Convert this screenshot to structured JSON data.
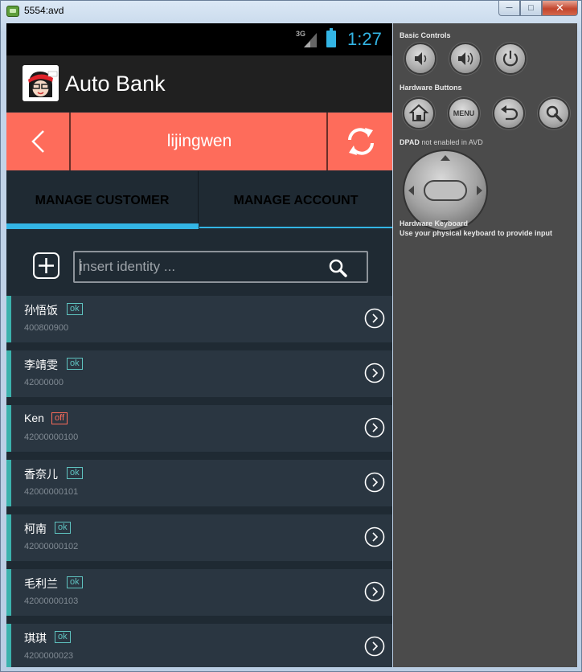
{
  "window": {
    "title": "5554:avd",
    "minimize": "─",
    "maximize": "□",
    "close": "✕"
  },
  "status_bar": {
    "network": "3G",
    "clock": "1:27",
    "icons": [
      "signal-icon",
      "battery-charging-icon"
    ]
  },
  "app_bar": {
    "title": "Auto Bank",
    "logo": "avatar-logo"
  },
  "user_bar": {
    "username": "lijingwen",
    "back_icon": "chevron-left-icon",
    "refresh_icon": "refresh-icon"
  },
  "tabs": [
    {
      "label": "MANAGE CUSTOMER",
      "selected": true
    },
    {
      "label": "MANAGE ACCOUNT",
      "selected": false
    }
  ],
  "search": {
    "placeholder": "insert identity ...",
    "value": ""
  },
  "customers": [
    {
      "name": "孙悟饭",
      "status": "ok",
      "id": "400800900"
    },
    {
      "name": "李靖雯",
      "status": "ok",
      "id": "42000000"
    },
    {
      "name": "Ken",
      "status": "off",
      "id": "42000000100"
    },
    {
      "name": "香奈儿",
      "status": "ok",
      "id": "42000000101"
    },
    {
      "name": "柯南",
      "status": "ok",
      "id": "42000000102"
    },
    {
      "name": "毛利兰",
      "status": "ok",
      "id": "42000000103"
    },
    {
      "name": "琪琪",
      "status": "ok",
      "id": "4200000023"
    }
  ],
  "emulator_panel": {
    "basic_controls": "Basic Controls",
    "hardware_buttons": "Hardware Buttons",
    "menu_label": "MENU",
    "dpad_title": "DPAD",
    "dpad_note": "not enabled in AVD",
    "keyboard_title": "Hardware Keyboard",
    "keyboard_note": "Use your physical keyboard to provide input"
  },
  "colors": {
    "accent_blue": "#33b5e5",
    "user_bar": "#fe6c5b",
    "row_stripe": "#3cb2ad",
    "ok_badge": "#5fc3c0",
    "off_badge": "#fe6c5b"
  }
}
